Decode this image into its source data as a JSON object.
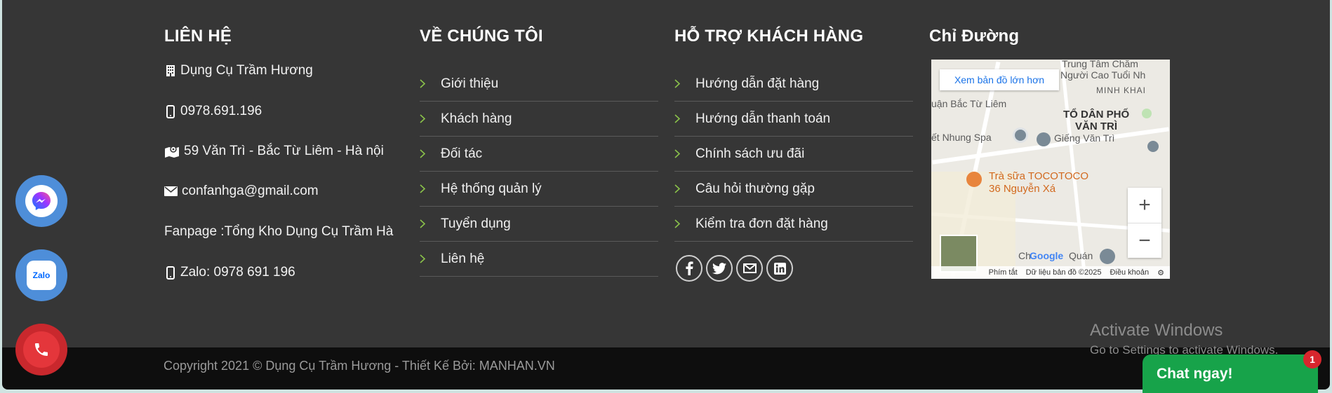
{
  "contact": {
    "heading": "LIÊN HỆ",
    "items": [
      {
        "icon": "building-icon",
        "text": "Dụng Cụ Trầm Hương"
      },
      {
        "icon": "mobile-icon",
        "text": "0978.691.196"
      },
      {
        "icon": "map-icon",
        "text": "59 Văn Trì - Bắc Từ Liêm - Hà nội"
      },
      {
        "icon": "envelope-icon",
        "text": "confanhga@gmail.com"
      },
      {
        "icon": "",
        "text": "Fanpage :Tổng Kho Dụng Cụ Trầm Hà"
      },
      {
        "icon": "mobile-icon",
        "text": "Zalo: 0978 691 196"
      }
    ]
  },
  "about": {
    "heading": "VỀ CHÚNG TÔI",
    "links": [
      "Giới thiệu",
      "Khách hàng",
      "Đối tác",
      "Hệ thống quản lý",
      "Tuyển dụng",
      "Liên hệ"
    ]
  },
  "support": {
    "heading": "HỖ TRỢ KHÁCH HÀNG",
    "links": [
      "Hướng dẫn đặt hàng",
      "Hướng dẫn thanh toán",
      "Chính sách ưu đãi",
      "Câu hỏi thường gặp",
      "Kiểm tra đơn đặt hàng"
    ],
    "socials": [
      "facebook-icon",
      "twitter-icon",
      "email-icon",
      "linkedin-icon"
    ]
  },
  "directions": {
    "heading": "Chỉ Đường",
    "map": {
      "enlarge_label": "Xem bản đồ lớn hơn",
      "labels": [
        "Trung Tâm Chăm",
        "Người Cao Tuổi Nh",
        "MINH KHAI",
        "uận Bắc Từ Liêm",
        "TỔ DÂN PHỐ",
        "VĂN TRÌ",
        "ết Nhung Spa",
        "Giếng Văn Trì",
        "Trà sữa TOCOTOCO",
        "36 Nguyễn Xá",
        "Ch",
        "Quán"
      ],
      "google": "Google",
      "zoom_in": "+",
      "zoom_out": "−",
      "footer": [
        "Phím tắt",
        "Dữ liệu bản đồ ©2025",
        "Điều khoản"
      ]
    }
  },
  "copyright": "Copyright 2021 © Dụng Cụ Trầm Hương - Thiết Kế Bởi: MANHAN.VN",
  "floating": [
    "messenger-icon",
    "zalo-icon",
    "phone-icon"
  ],
  "zalo_label": "Zalo",
  "activate": {
    "line1": "Activate Windows",
    "line2": "Go to Settings to activate Windows."
  },
  "chat": {
    "label": "Chat ngay!",
    "badge": "1"
  },
  "colors": {
    "footer_bg": "#363636",
    "bottom_bg": "#0e0e0e",
    "chat_green": "#17a34a",
    "phone_red": "#d8262d",
    "accent_chevron": "#8bc34a"
  }
}
